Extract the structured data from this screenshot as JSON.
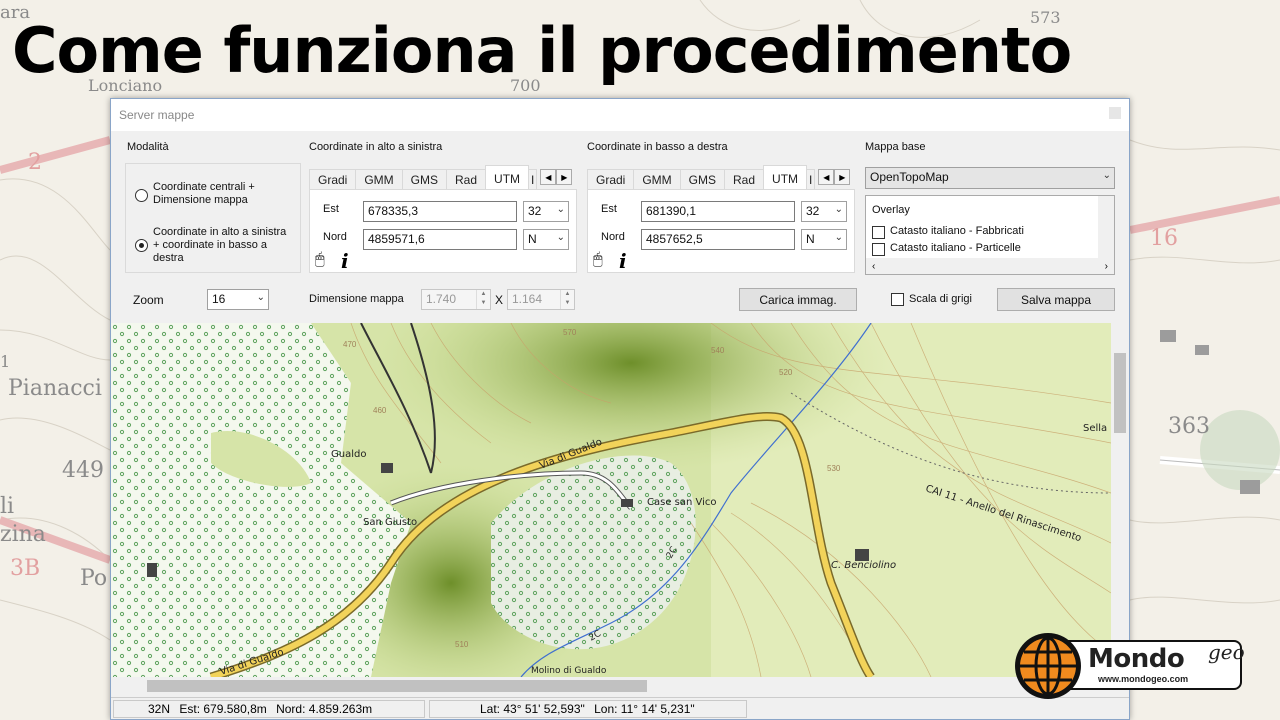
{
  "slide": {
    "title": "Come funziona il procedimento"
  },
  "background_map": {
    "labels": [
      "Pianacci",
      "449",
      "363",
      "Po",
      "2",
      "3B",
      "16",
      "573",
      "1",
      "zina",
      "ara",
      "Lonciano",
      "700",
      "li"
    ]
  },
  "window": {
    "title": "Server mappe",
    "modalita": {
      "label": "Modalità",
      "options": [
        "Coordinate centrali + Dimensione mappa",
        "Coordinate in alto a sinistra + coordinate in basso a destra"
      ],
      "selected": 1
    },
    "top_left": {
      "label": "Coordinate in alto a sinistra",
      "tabs": [
        "Gradi",
        "GMM",
        "GMS",
        "Rad",
        "UTM",
        "I"
      ],
      "active_tab": "UTM",
      "est_label": "Est",
      "est_value": "678335,3",
      "zone": "32",
      "nord_label": "Nord",
      "nord_value": "4859571,6",
      "hemisphere": "N"
    },
    "bottom_right": {
      "label": "Coordinate in basso a destra",
      "tabs": [
        "Gradi",
        "GMM",
        "GMS",
        "Rad",
        "UTM",
        "I"
      ],
      "active_tab": "UTM",
      "est_label": "Est",
      "est_value": "681390,1",
      "zone": "32",
      "nord_label": "Nord",
      "nord_value": "4857652,5",
      "hemisphere": "N"
    },
    "base_map": {
      "label": "Mappa base",
      "selected": "OpenTopoMap",
      "overlay_label": "Overlay",
      "overlays": [
        "Catasto italiano - Fabbricati",
        "Catasto italiano - Particelle"
      ]
    },
    "zoom": {
      "label": "Zoom",
      "value": "16"
    },
    "map_size": {
      "label": "Dimensione mappa",
      "width": "1.740",
      "x": "X",
      "height": "1.164"
    },
    "load_button": "Carica immag.",
    "grayscale_label": "Scala di grigi",
    "save_button": "Salva mappa",
    "map_labels": {
      "road1": "Via di Gualdo",
      "road2": "Via di Gualdo",
      "gualdo": "Gualdo",
      "san_giusto": "San Giusto",
      "case_san_vico": "Case san Vico",
      "trail": "CAI 11 - Anello del Rinascimento",
      "benciolino": "C. Benciolino",
      "sella": "Sella",
      "mulino": "Molino di Gualdo",
      "path1": "2C",
      "path2": "2C",
      "c470": "470",
      "c460": "460",
      "c570": "570",
      "c540": "540",
      "c520": "520",
      "c530": "530",
      "c510": "510"
    },
    "status": {
      "zone": "32N",
      "est": "Est: 679.580,8m",
      "nord": "Nord: 4.859.263m",
      "lat": "Lat: 43° 51' 52,593\"",
      "lon": "Lon: 11° 14' 5,231\""
    }
  },
  "logo": {
    "name": "Mondo",
    "suffix": "geo",
    "url": "www.mondogeo.com"
  }
}
